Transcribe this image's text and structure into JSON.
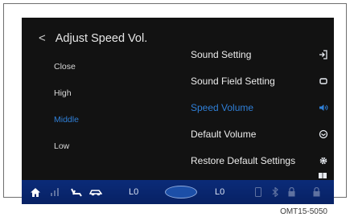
{
  "header": {
    "title": "Adjust Speed Vol."
  },
  "levels": {
    "items": [
      {
        "label": "Close",
        "active": false
      },
      {
        "label": "High",
        "active": false
      },
      {
        "label": "Middle",
        "active": true
      },
      {
        "label": "Low",
        "active": false
      }
    ]
  },
  "menu": {
    "items": [
      {
        "label": "Sound Setting",
        "icon": "sound-setting-icon",
        "active": false
      },
      {
        "label": "Sound Field Setting",
        "icon": "sound-field-icon",
        "active": false
      },
      {
        "label": "Speed Volume",
        "icon": "speaker-icon",
        "active": true
      },
      {
        "label": "Default Volume",
        "icon": "default-volume-icon",
        "active": false
      },
      {
        "label": "Restore Default Settings",
        "icon": "gear-icon",
        "active": false
      }
    ],
    "extra_icon": "book-icon"
  },
  "status_bar": {
    "left_temp": "L0",
    "right_temp": "L0"
  },
  "caption": "OMT15-5050",
  "colors": {
    "accent": "#2f7fd7",
    "status_bar": "#0b2b78",
    "screen_bg": "#121212"
  }
}
